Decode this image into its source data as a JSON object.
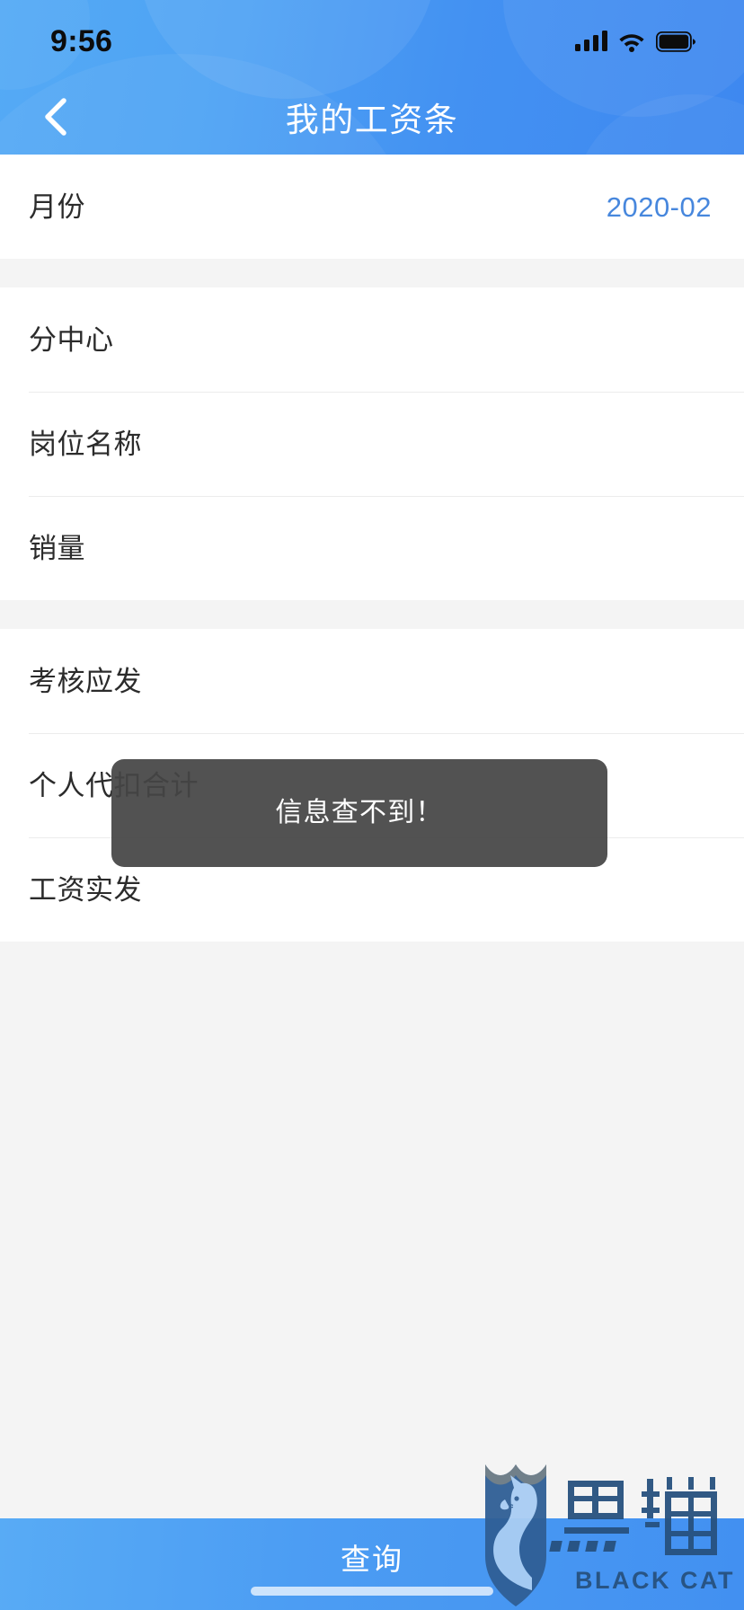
{
  "status_bar": {
    "time": "9:56",
    "signal_icon": "cellular-signal-icon",
    "wifi_icon": "wifi-icon",
    "battery_icon": "battery-full-icon"
  },
  "nav": {
    "back_icon": "chevron-left-icon",
    "title": "我的工资条"
  },
  "form": {
    "groups": [
      {
        "rows": [
          {
            "label": "月份",
            "value": "2020-02",
            "value_color": "#4787dd",
            "interactable": true
          }
        ]
      },
      {
        "rows": [
          {
            "label": "分中心",
            "value": "",
            "interactable": true
          },
          {
            "label": "岗位名称",
            "value": "",
            "interactable": true
          },
          {
            "label": "销量",
            "value": "",
            "interactable": true
          }
        ]
      },
      {
        "rows": [
          {
            "label": "考核应发",
            "value": "",
            "interactable": true
          },
          {
            "label": "个人代扣合计",
            "value": "",
            "interactable": true
          },
          {
            "label": "工资实发",
            "value": "",
            "interactable": true
          }
        ]
      }
    ]
  },
  "toast": {
    "message": "信息查不到！",
    "background": "#454545",
    "text_color": "#ffffff"
  },
  "bottom": {
    "query_label": "查询",
    "background_accent": "#4a9bf2"
  },
  "watermark": {
    "cn_text": "黑猫",
    "en_text": "BLACK CAT",
    "icon": "black-cat-shield-logo"
  },
  "theme": {
    "header_gradient_from": "#55aaf5",
    "header_gradient_to": "#3e88f0",
    "page_background": "#f4f4f4",
    "card_background": "#ffffff",
    "label_color": "#2b2b2b",
    "divider_color": "#ececec",
    "accent_blue": "#4787dd"
  }
}
